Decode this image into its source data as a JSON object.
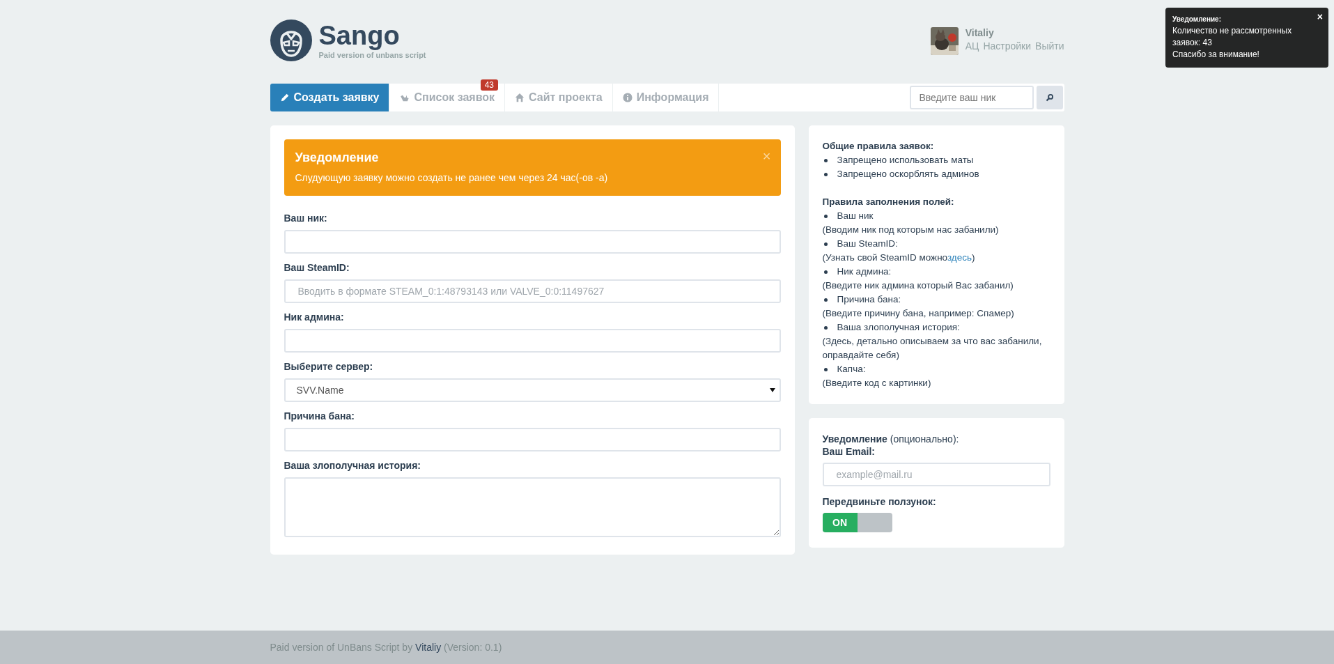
{
  "toast": {
    "title": "Уведомление:",
    "close": "×",
    "text": "Количество не рассмотренных заявок: 43",
    "footer": "Спасибо за внимание!"
  },
  "logo": {
    "name": "Sango",
    "tagline": "Paid version of unbans script"
  },
  "user": {
    "name": "Vitaliy",
    "links": [
      "АЦ",
      "Настройки",
      "Выйти"
    ]
  },
  "nav": {
    "tabs": [
      {
        "label": "Создать заявку",
        "selected": true
      },
      {
        "label": "Список заявок",
        "selected": false,
        "badge": "43"
      },
      {
        "label": "Сайт проекта",
        "selected": false
      },
      {
        "label": "Информация",
        "selected": false
      }
    ],
    "search": {
      "placeholder": "Введите ваш ник"
    }
  },
  "alert": {
    "title": "Уведомление",
    "text": "Слудующую заявку можно создать не ранее чем через 24 час(-ов -а)",
    "close": "×"
  },
  "form": {
    "fields": [
      {
        "label": "Ваш ник:",
        "kind": "input"
      },
      {
        "label": "Ваш SteamID:",
        "kind": "input",
        "placeholder": "Вводить в формате STEAM_0:1:48793143 или VALVE_0:0:11497627"
      },
      {
        "label": "Ник админа:",
        "kind": "input"
      },
      {
        "label": "Выберите сервер:",
        "kind": "select",
        "value": "SVV.Name"
      },
      {
        "label": "Причина бана:",
        "kind": "input"
      },
      {
        "label": "Ваша злополучная история:",
        "kind": "textarea"
      }
    ]
  },
  "rules": {
    "sections": [
      {
        "title": "Общие правила заявок:",
        "items": [
          {
            "text": "Запрещено использовать маты"
          },
          {
            "text": "Запрещено оскорблять админов"
          }
        ]
      },
      {
        "title": "Правила заполнения полей:",
        "items": [
          {
            "text": "Ваш ник",
            "note": "(Вводим ник под которым нас забанили)"
          },
          {
            "text": "Ваш SteamID:",
            "note": "(Узнать свой SteamID можно",
            "link": "здесь",
            "note_end": ")"
          },
          {
            "text": "Ник админа:",
            "note": "(Введите ник админа который Вас забанил)"
          },
          {
            "text": "Причина бана:",
            "note": "(Введите причину бана, например: Спамер)"
          },
          {
            "text": "Ваша злополучная история:",
            "note": "(Здесь, детально описываем за что вас забанили, оправдайте себя)"
          },
          {
            "text": "Капча:",
            "note": "(Введите код с картинки)"
          }
        ]
      }
    ]
  },
  "notify": {
    "heading": "**Уведомление** (опционально):",
    "email_label": "Ваш Email:",
    "email_placeholder": "example@mail.ru",
    "slider_label": "Передвиньте ползунок:",
    "toggle": {
      "label": "ON",
      "on": true
    }
  },
  "footer": {
    "text": "Paid version of UnBans Script by",
    "author": "Vitaliy",
    "version": "(Version: 0.1)"
  }
}
